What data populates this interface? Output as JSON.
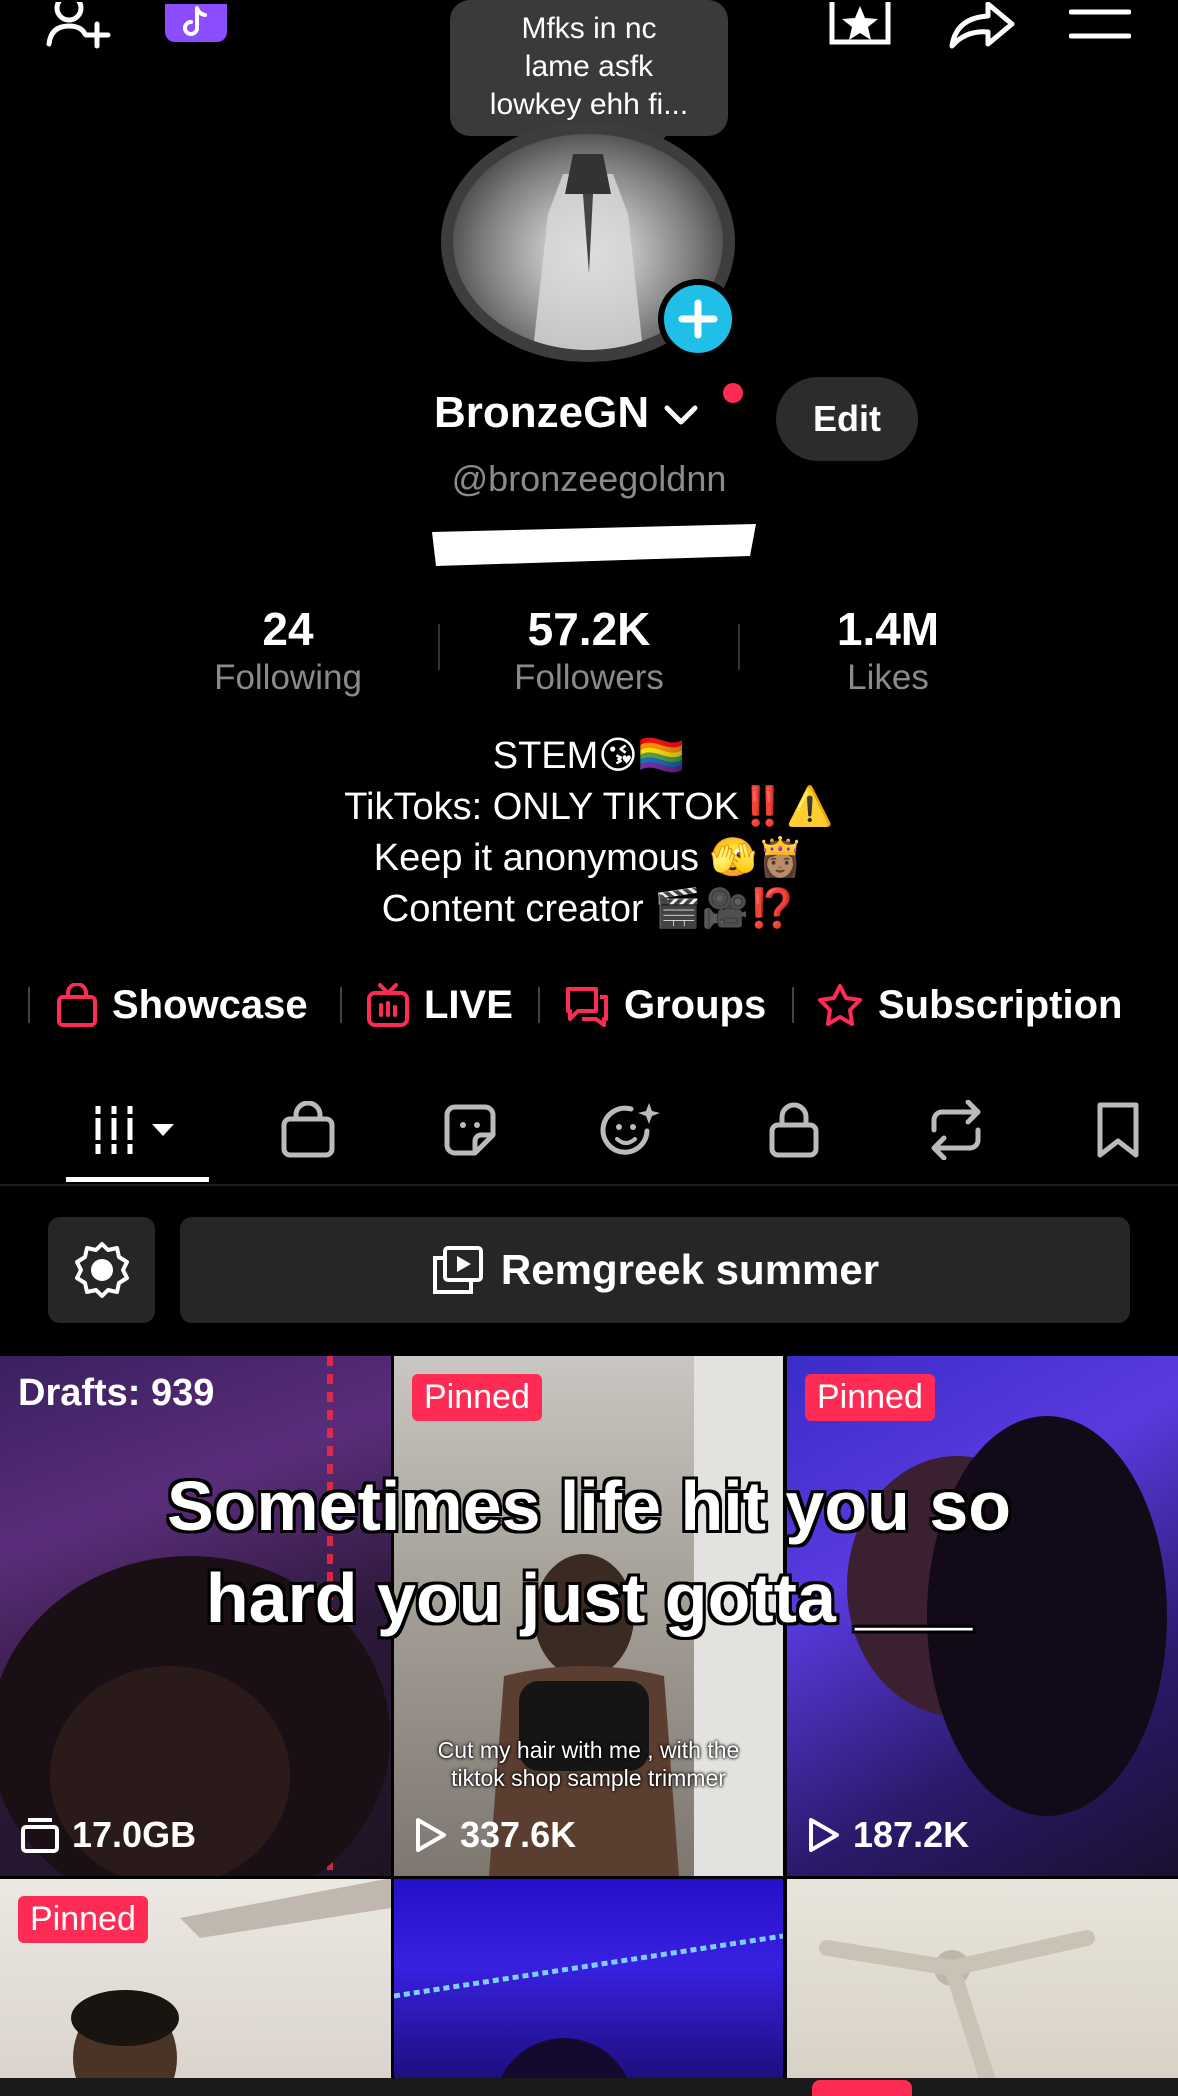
{
  "header": {
    "note_bubble": [
      "Mfks in nc",
      "lame asfk",
      "lowkey ehh fi..."
    ]
  },
  "profile": {
    "display_name": "BronzeGN",
    "handle": "@bronzeegoldnn",
    "edit_label": "Edit"
  },
  "stats": [
    {
      "value": "24",
      "label": "Following"
    },
    {
      "value": "57.2K",
      "label": "Followers"
    },
    {
      "value": "1.4M",
      "label": "Likes"
    }
  ],
  "bio": [
    "STEM😘🏳️‍🌈",
    "TikToks: ONLY TIKTOK‼️⚠️",
    "Keep it anonymous 🫣👸🏽",
    "Content creator 🎬🎥⁉️"
  ],
  "links": [
    {
      "label": "Showcase",
      "icon": "shopping-bag-icon"
    },
    {
      "label": "LIVE",
      "icon": "live-tv-icon"
    },
    {
      "label": "Groups",
      "icon": "chat-bubbles-icon"
    },
    {
      "label": "Subscription",
      "icon": "star-badge-icon"
    }
  ],
  "tabs": [
    "videos-grid-icon",
    "shop-bag-icon",
    "sticker-icon",
    "face-sparkle-icon",
    "lock-icon",
    "repost-icon",
    "bookmark-icon"
  ],
  "collection": {
    "title": "Remgreek summer"
  },
  "grid": {
    "drafts_label": "Drafts: 939",
    "drafts_size": "17.0GB",
    "pinned_label": "Pinned",
    "tiles": [
      {
        "views": "337.6K",
        "subtitle": [
          "Cut my hair with me , with the",
          "tiktok shop sample trimmer"
        ]
      },
      {
        "views": "187.2K"
      }
    ]
  },
  "overlay_caption": [
    "Sometimes life hit you so",
    "hard you just gotta ___"
  ],
  "colors": {
    "accent_red": "#fe2c55",
    "accent_cyan": "#20bfe8",
    "background": "#000000"
  }
}
